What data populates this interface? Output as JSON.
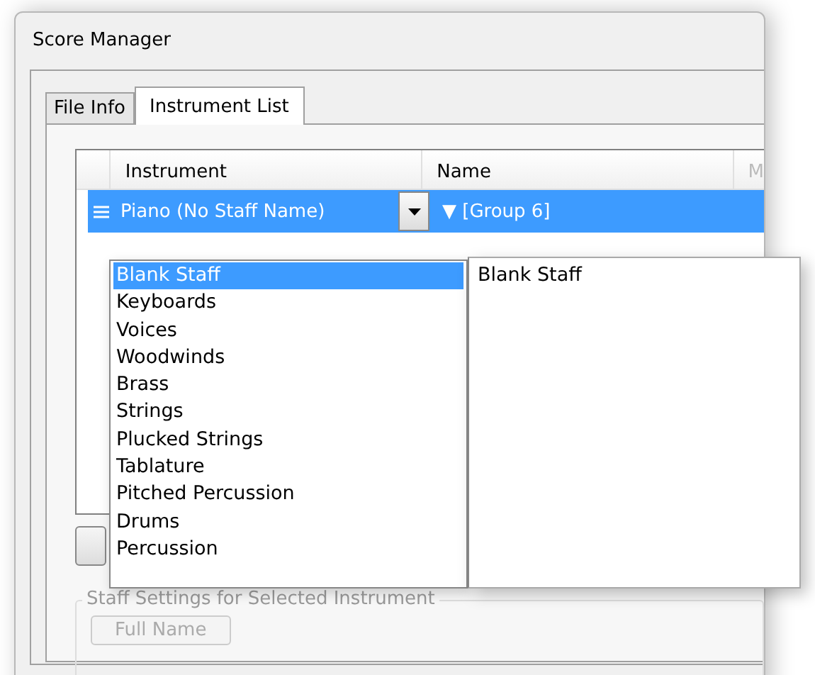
{
  "window": {
    "title": "Score Manager"
  },
  "tabs": [
    {
      "label": "File Info",
      "selected": false
    },
    {
      "label": "Instrument List",
      "selected": true
    }
  ],
  "grid": {
    "columns": [
      "Instrument",
      "Name",
      "M"
    ],
    "rows": [
      {
        "instrument": "Piano (No Staff Name)",
        "name": "▼ [Group 6]",
        "selected": true
      }
    ]
  },
  "dropdown": {
    "categories": [
      {
        "label": "Blank Staff",
        "selected": true
      },
      {
        "label": "Keyboards",
        "selected": false
      },
      {
        "label": "Voices",
        "selected": false
      },
      {
        "label": "Woodwinds",
        "selected": false
      },
      {
        "label": "Brass",
        "selected": false
      },
      {
        "label": "Strings",
        "selected": false
      },
      {
        "label": "Plucked Strings",
        "selected": false
      },
      {
        "label": "Tablature",
        "selected": false
      },
      {
        "label": "Pitched Percussion",
        "selected": false
      },
      {
        "label": "Drums",
        "selected": false
      },
      {
        "label": "Percussion",
        "selected": false
      }
    ],
    "instruments": [
      {
        "label": "Blank Staff"
      }
    ]
  },
  "staff_settings": {
    "title": "Staff Settings for Selected Instrument",
    "button": "Full Name"
  }
}
